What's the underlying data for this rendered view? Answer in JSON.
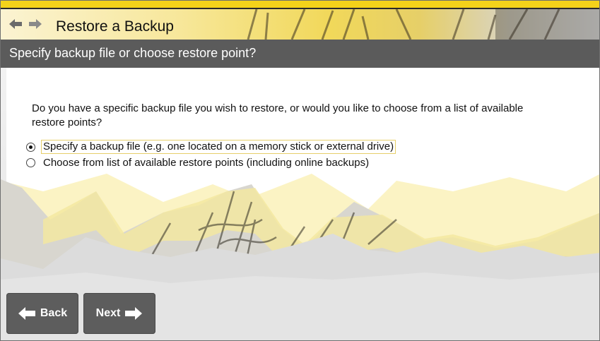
{
  "header": {
    "title": "Restore a Backup",
    "back_arrow_icon": "left-arrow-icon",
    "forward_arrow_icon": "right-arrow-icon"
  },
  "subheader": {
    "title": "Specify backup file or choose restore point?"
  },
  "main": {
    "question": "Do you have a specific backup file you wish to restore, or would you like to choose from a list of available restore points?",
    "options": [
      {
        "label": "Specify a backup file (e.g. one located on a memory stick or external drive)",
        "selected": true
      },
      {
        "label": "Choose from list of available restore points (including online backups)",
        "selected": false
      }
    ]
  },
  "footer": {
    "back_label": "Back",
    "next_label": "Next"
  },
  "colors": {
    "accent_yellow": "#f4d21a",
    "subheader_gray": "#5b5b5b",
    "button_gray": "#5d5d5d"
  }
}
